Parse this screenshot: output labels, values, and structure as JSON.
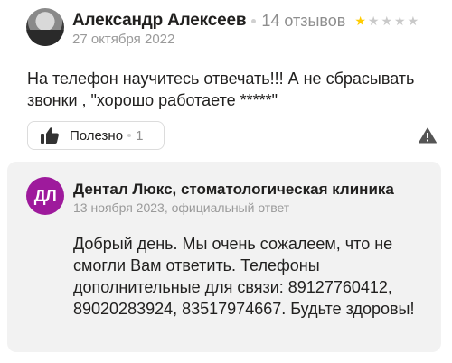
{
  "review": {
    "author": "Александр Алексеев",
    "reviews_count": "14 отзывов",
    "rating": 1,
    "rating_max": 5,
    "date": "27 октября 2022",
    "text": "На телефон научитесь отвечать!!! А не сбрасывать звонки , \"хорошо работаете *****\"",
    "useful_label": "Полезно",
    "useful_count": "1",
    "star_color": "#ffcc00",
    "star_empty_color": "#c9c9c9",
    "icons": {
      "like": "thumbs-up-icon",
      "report": "warning-triangle-icon"
    }
  },
  "reply": {
    "avatar_initials": "ДЛ",
    "avatar_color": "#9e1a9c",
    "org_name": "Дентал Люкс, стоматологическая клиника",
    "date": "13 ноября 2023, официальный ответ",
    "text": "Добрый день. Мы очень сожалеем, что не смогли Вам ответить. Телефоны дополнительные для связи: 89127760412, 89020283924, 83517974667. Будьте здоровы!"
  }
}
